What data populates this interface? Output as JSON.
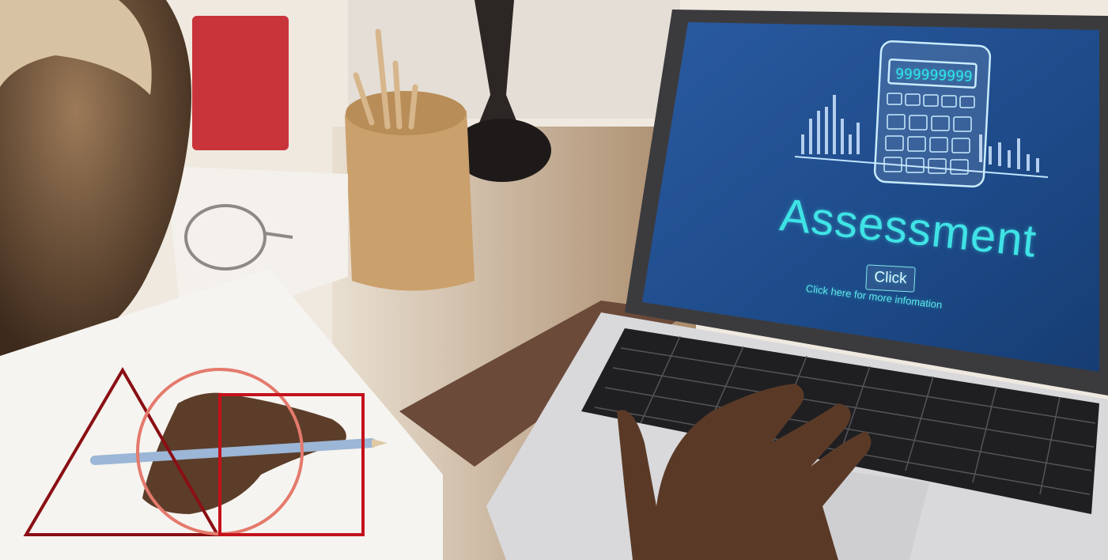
{
  "screen": {
    "headline": "Assessment",
    "button_label": "Click",
    "subline": "Click here for more infomation",
    "calculator_display": "999999999"
  },
  "colors": {
    "screen_blue": "#1f4e8c",
    "screen_text": "#3fe3e6",
    "triangle_stroke": "#8a0f14",
    "circle_stroke": "#e47a6c",
    "square_stroke": "#c4121c"
  }
}
